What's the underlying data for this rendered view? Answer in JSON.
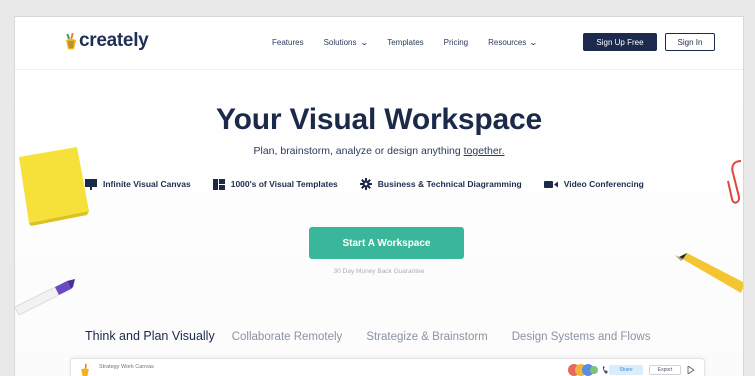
{
  "header": {
    "logo_text": "creately",
    "nav": [
      {
        "label": "Features",
        "has_dropdown": false
      },
      {
        "label": "Solutions",
        "has_dropdown": true
      },
      {
        "label": "Templates",
        "has_dropdown": false
      },
      {
        "label": "Pricing",
        "has_dropdown": false
      },
      {
        "label": "Resources",
        "has_dropdown": true
      }
    ],
    "signup_label": "Sign Up Free",
    "signin_label": "Sign In"
  },
  "hero": {
    "title": "Your Visual Workspace",
    "subtitle_before": "Plan, brainstorm, analyze or design anything ",
    "subtitle_link": "together.",
    "features": [
      {
        "icon": "canvas-icon",
        "label": "Infinite Visual Canvas"
      },
      {
        "icon": "templates-icon",
        "label": "1000's of Visual Templates"
      },
      {
        "icon": "gear-icon",
        "label": "Business & Technical Diagramming"
      },
      {
        "icon": "video-icon",
        "label": "Video Conferencing"
      }
    ],
    "cta_label": "Start A Workspace",
    "guarantee": "30 Day Money Back Guarantee"
  },
  "tabs": [
    {
      "label": "Think and Plan Visually",
      "active": true
    },
    {
      "label": "Collaborate Remotely",
      "active": false
    },
    {
      "label": "Strategize & Brainstorm",
      "active": false
    },
    {
      "label": "Design Systems and Flows",
      "active": false
    }
  ],
  "preview": {
    "title": "Strategy Work Canvas",
    "share_label": "Share",
    "export_label": "Export"
  },
  "colors": {
    "navy": "#1d2a4d",
    "teal": "#3ab79a",
    "sticky_yellow": "#f5e13a",
    "marker_purple": "#6a4bc2",
    "pencil_yellow": "#f3c531",
    "clip_red": "#e0463b"
  }
}
